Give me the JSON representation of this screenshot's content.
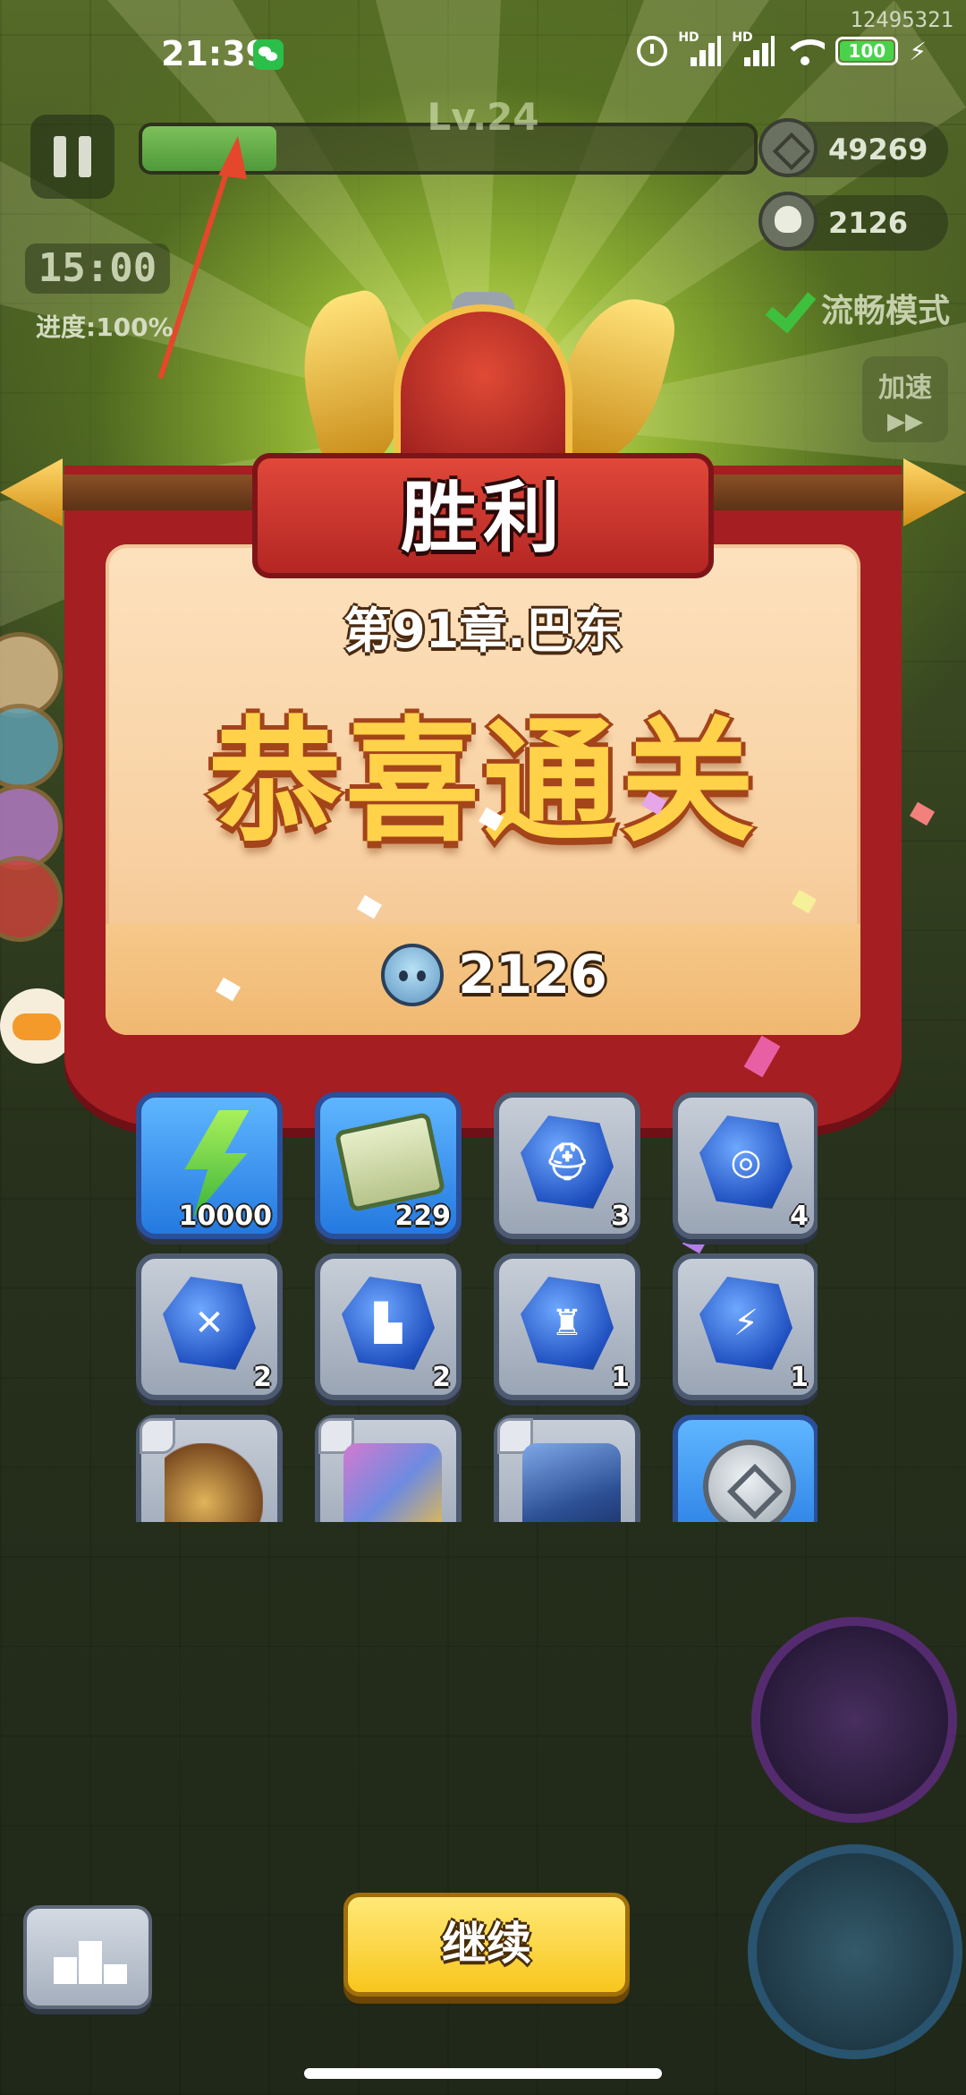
{
  "status_bar": {
    "time": "21:39",
    "build_id": "12495321",
    "signal_1_label": "HD",
    "signal_2_label": "HD",
    "battery_level": "100",
    "icons": [
      "wechat-icon",
      "alarm-icon",
      "signal-icon",
      "wifi-icon",
      "battery-icon",
      "charging-icon"
    ]
  },
  "hud": {
    "level": "Lv.24",
    "xp_progress": 0.22,
    "coins": "49269",
    "skulls": "2126",
    "timer": "15:00",
    "progress_text": "进度:100%",
    "smooth_mode_label": "流畅模式",
    "speed_label": "加速",
    "speed_icon": "▶▶"
  },
  "victory": {
    "title": "胜利",
    "chapter": "第91章.巴东",
    "congrats": "恭喜通关",
    "skull_reward": "2126"
  },
  "rewards": [
    {
      "icon": "energy-bolt-icon",
      "qty": "10000",
      "frame": "blue"
    },
    {
      "icon": "scroll-icon",
      "qty": "229",
      "frame": "blue"
    },
    {
      "icon": "helmet-gem-icon",
      "qty": "3",
      "frame": "gray",
      "symbol": "⛑"
    },
    {
      "icon": "medal-gem-icon",
      "qty": "4",
      "frame": "gray",
      "symbol": "◎"
    },
    {
      "icon": "sword-gem-icon",
      "qty": "2",
      "frame": "gray",
      "symbol": "✕"
    },
    {
      "icon": "boot-gem-icon",
      "qty": "2",
      "frame": "gray",
      "symbol": "▙"
    },
    {
      "icon": "armor-gem-icon",
      "qty": "1",
      "frame": "gray",
      "symbol": "♜"
    },
    {
      "icon": "gloves-gem-icon",
      "qty": "1",
      "frame": "gray",
      "symbol": "⚡"
    },
    {
      "icon": "necklace-icon",
      "qty": "",
      "frame": "gray"
    },
    {
      "icon": "robe-icon",
      "qty": "",
      "frame": "gray"
    },
    {
      "icon": "helm-equip-icon",
      "qty": "",
      "frame": "gray"
    },
    {
      "icon": "silver-coin-icon",
      "qty": "",
      "frame": "blue"
    }
  ],
  "bottom": {
    "continue_label": "继续"
  },
  "colors": {
    "victory_red": "#b42623",
    "gold_text": "#ffd24a",
    "continue_yellow": "#f8c61c"
  }
}
